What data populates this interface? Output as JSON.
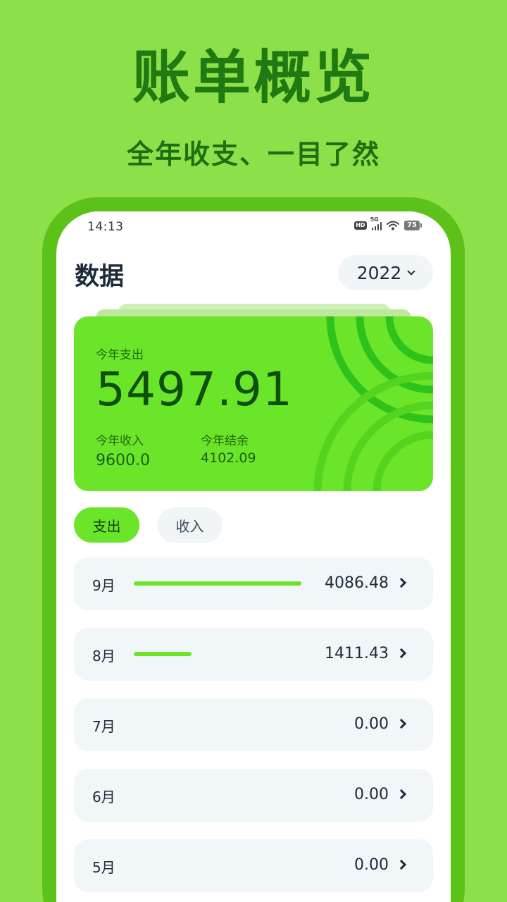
{
  "promo": {
    "title": "账单概览",
    "subtitle": "全年收支、一目了然"
  },
  "status_bar": {
    "time": "14:13",
    "network": "5G",
    "hd_badge": "HD",
    "battery": "75",
    "icons": [
      "hd-icon",
      "signal-5g-icon",
      "wifi-icon",
      "battery-icon"
    ]
  },
  "header": {
    "title": "数据",
    "year": "2022"
  },
  "summary": {
    "expense_label": "今年支出",
    "expense_value": "5497.91",
    "income_label": "今年收入",
    "income_value": "9600.0",
    "balance_label": "今年结余",
    "balance_value": "4102.09"
  },
  "tabs": [
    {
      "label": "支出",
      "active": true
    },
    {
      "label": "收入",
      "active": false
    }
  ],
  "months": [
    {
      "label": "9月",
      "value": "4086.48",
      "amount": 4086.48
    },
    {
      "label": "8月",
      "value": "1411.43",
      "amount": 1411.43
    },
    {
      "label": "7月",
      "value": "0.00",
      "amount": 0
    },
    {
      "label": "6月",
      "value": "0.00",
      "amount": 0
    },
    {
      "label": "5月",
      "value": "0.00",
      "amount": 0
    }
  ],
  "colors": {
    "background": "#8ee04a",
    "frame": "#5cc219",
    "accent": "#6be52a",
    "title": "#1f7a12",
    "row_bg": "#f1f6f9"
  }
}
